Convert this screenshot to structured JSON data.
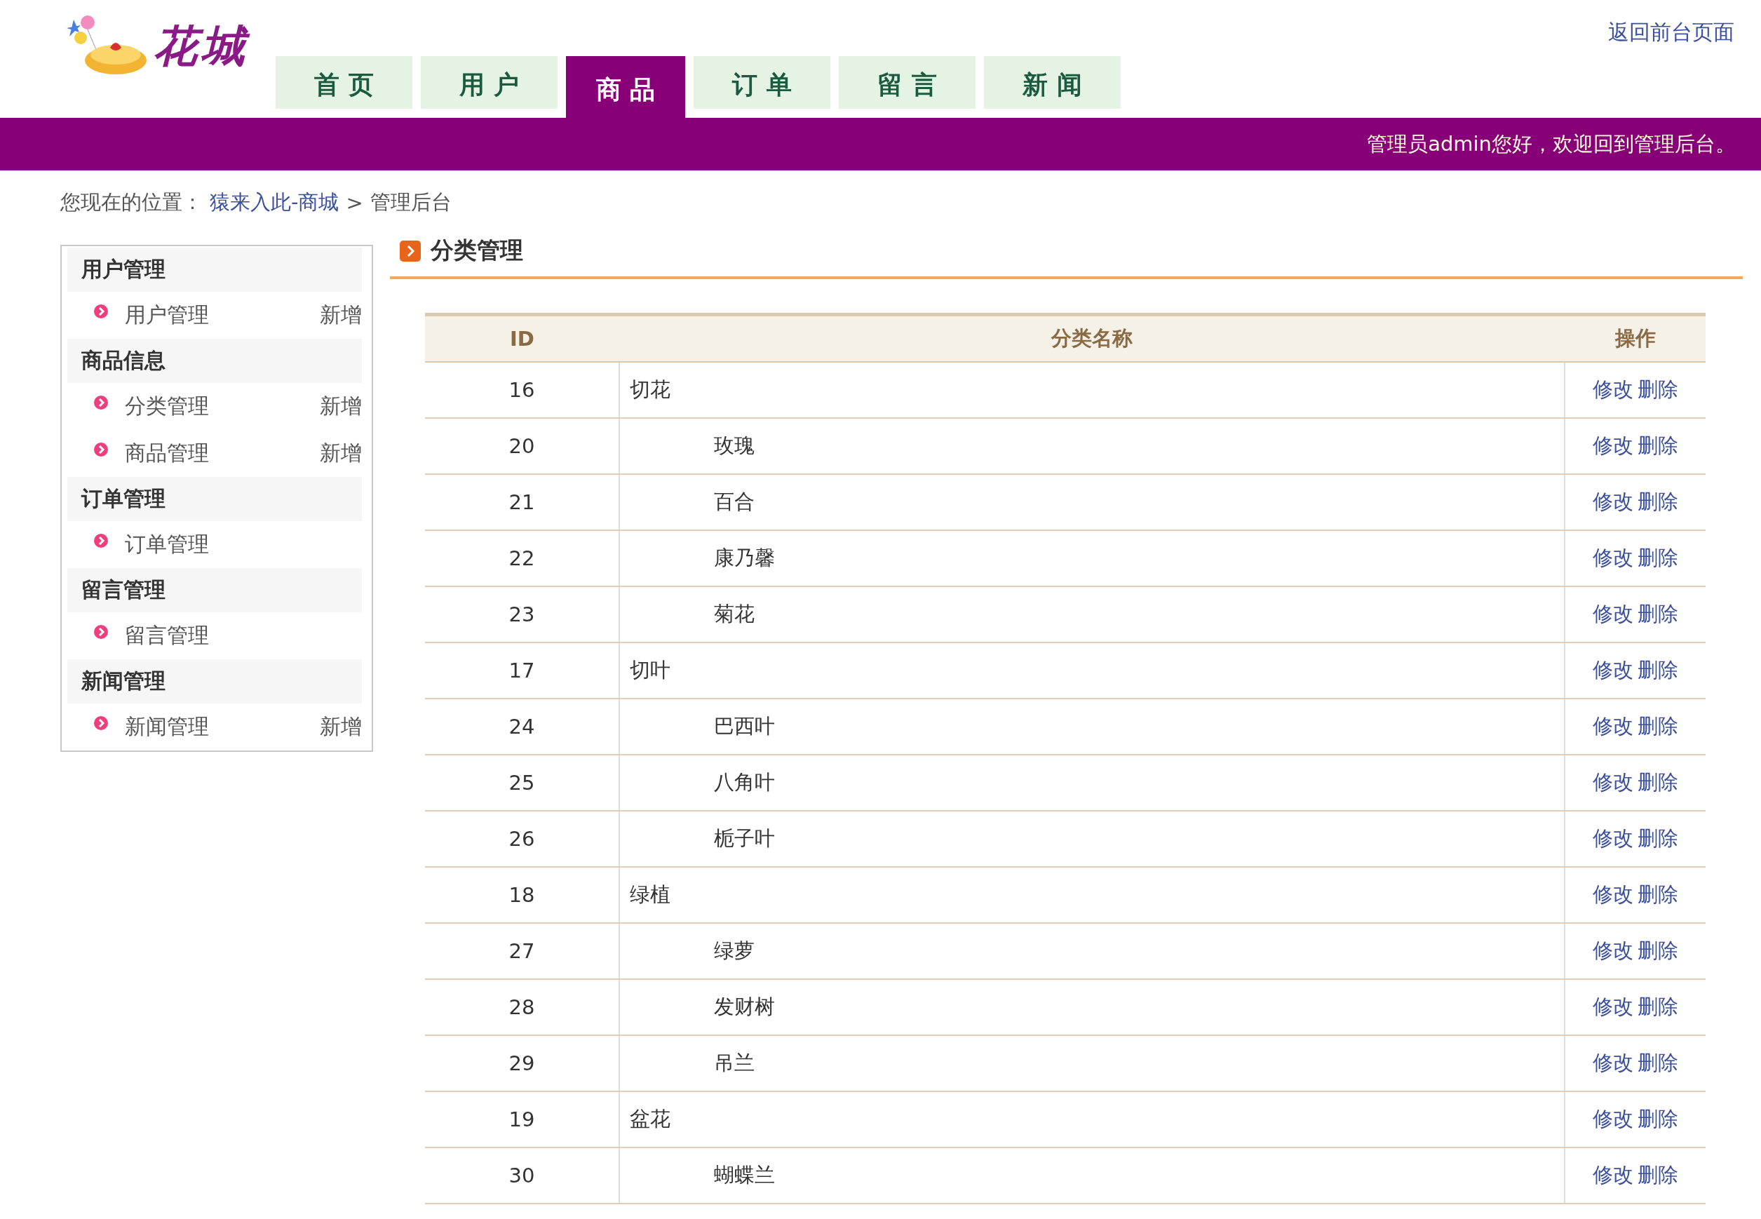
{
  "header": {
    "logo_text": "花城",
    "back_link": "返回前台页面",
    "tabs": [
      {
        "label": "首 页",
        "selected": false
      },
      {
        "label": "用 户",
        "selected": false
      },
      {
        "label": "商 品",
        "selected": true
      },
      {
        "label": "订 单",
        "selected": false
      },
      {
        "label": "留 言",
        "selected": false
      },
      {
        "label": "新 闻",
        "selected": false
      }
    ],
    "welcome": "管理员admin您好，欢迎回到管理后台。"
  },
  "breadcrumb": {
    "prefix": "您现在的位置：",
    "link": "猿来入此-商城",
    "separator": ">",
    "current": "管理后台"
  },
  "sidebar": {
    "groups": [
      {
        "title": "用户管理",
        "items": [
          {
            "label": "用户管理",
            "action": "新增"
          }
        ]
      },
      {
        "title": "商品信息",
        "items": [
          {
            "label": "分类管理",
            "action": "新增"
          },
          {
            "label": "商品管理",
            "action": "新增"
          }
        ]
      },
      {
        "title": "订单管理",
        "items": [
          {
            "label": "订单管理"
          }
        ]
      },
      {
        "title": "留言管理",
        "items": [
          {
            "label": "留言管理"
          }
        ]
      },
      {
        "title": "新闻管理",
        "items": [
          {
            "label": "新闻管理",
            "action": "新增"
          }
        ]
      }
    ]
  },
  "content": {
    "title": "分类管理",
    "table": {
      "columns": [
        "ID",
        "分类名称",
        "操作"
      ],
      "rows": [
        {
          "id": "16",
          "name": "切花",
          "actions": [
            "修改",
            "删除"
          ],
          "children": [
            {
              "id": "20",
              "name": "玫瑰",
              "actions": [
                "修改",
                "删除"
              ]
            },
            {
              "id": "21",
              "name": "百合",
              "actions": [
                "修改",
                "删除"
              ]
            },
            {
              "id": "22",
              "name": "康乃馨",
              "actions": [
                "修改",
                "删除"
              ]
            },
            {
              "id": "23",
              "name": "菊花",
              "actions": [
                "修改",
                "删除"
              ]
            }
          ]
        },
        {
          "id": "17",
          "name": "切叶",
          "actions": [
            "修改",
            "删除"
          ],
          "children": [
            {
              "id": "24",
              "name": "巴西叶",
              "actions": [
                "修改",
                "删除"
              ]
            },
            {
              "id": "25",
              "name": "八角叶",
              "actions": [
                "修改",
                "删除"
              ]
            },
            {
              "id": "26",
              "name": "栀子叶",
              "actions": [
                "修改",
                "删除"
              ]
            }
          ]
        },
        {
          "id": "18",
          "name": "绿植",
          "actions": [
            "修改",
            "删除"
          ],
          "children": [
            {
              "id": "27",
              "name": "绿萝",
              "actions": [
                "修改",
                "删除"
              ]
            },
            {
              "id": "28",
              "name": "发财树",
              "actions": [
                "修改",
                "删除"
              ]
            },
            {
              "id": "29",
              "name": "吊兰",
              "actions": [
                "修改",
                "删除"
              ]
            }
          ]
        },
        {
          "id": "19",
          "name": "盆花",
          "actions": [
            "修改",
            "删除"
          ],
          "children": [
            {
              "id": "30",
              "name": "蝴蝶兰",
              "actions": [
                "修改",
                "删除"
              ]
            }
          ]
        }
      ]
    }
  }
}
